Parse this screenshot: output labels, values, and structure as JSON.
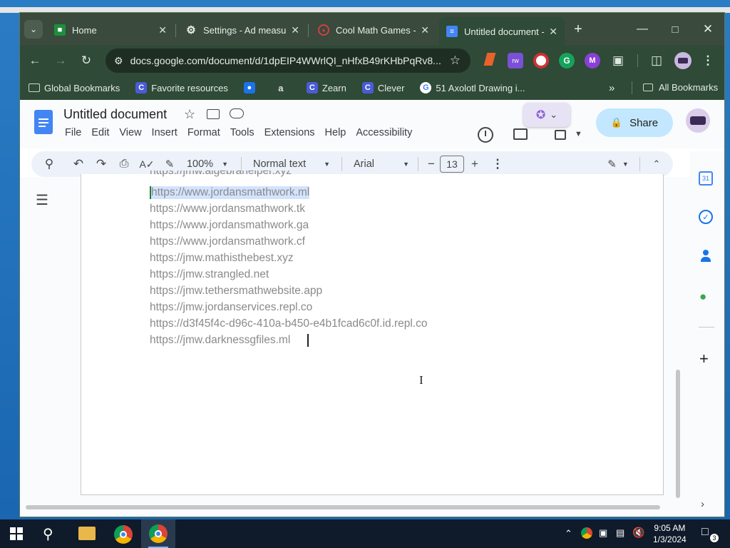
{
  "browser": {
    "tabs": [
      {
        "title": "Home",
        "icon": "classroom-icon",
        "active": false
      },
      {
        "title": "Settings - Ad measu",
        "icon": "gear-icon",
        "active": false
      },
      {
        "title": "Cool Math Games - F",
        "icon": "coolmath-icon",
        "active": false
      },
      {
        "title": "Untitled document -",
        "icon": "docs-icon",
        "active": true
      }
    ],
    "url": "docs.google.com/document/d/1dpEIP4WWrlQI_nHfxB49rKHbPqRv8...",
    "bookmarks": [
      {
        "label": "Global Bookmarks",
        "icon": "folder-icon"
      },
      {
        "label": "Favorite resources",
        "icon": "clever-icon"
      },
      {
        "label": "",
        "icon": "contacts-icon"
      },
      {
        "label": "",
        "icon": "app-icon"
      },
      {
        "label": "Zearn",
        "icon": "clever-icon"
      },
      {
        "label": "Clever",
        "icon": "clever-icon"
      },
      {
        "label": "51 Axolotl Drawing i...",
        "icon": "google-icon"
      }
    ],
    "all_bookmarks": "All Bookmarks",
    "extension_badge": "rw"
  },
  "docs": {
    "title": "Untitled document",
    "menu": [
      "File",
      "Edit",
      "View",
      "Insert",
      "Format",
      "Tools",
      "Extensions",
      "Help",
      "Accessibility"
    ],
    "share_label": "Share",
    "toolbar": {
      "zoom": "100%",
      "style": "Normal text",
      "font": "Arial",
      "font_size": "13"
    },
    "lines": [
      "https://jmw.algebrahelper.xyz",
      "https://www.jordansmathwork.ml",
      "https://www.jordansmathwork.tk",
      "https://www.jordansmathwork.ga",
      "https://www.jordansmathwork.cf",
      "https://jmw.mathisthebest.xyz",
      "https://jmw.strangled.net",
      "https://jmw.tethersmathwebsite.app",
      "https://jmw.jordanservices.repl.co",
      "https://d3f45f4c-d96c-410a-b450-e4b1fcad6c0f.id.repl.co",
      "https://jmw.darknessgfiles.ml"
    ],
    "side_apps": [
      "calendar-icon",
      "tasks-icon",
      "contacts-icon",
      "maps-icon",
      "add-icon"
    ]
  },
  "taskbar": {
    "time": "9:05 AM",
    "date": "1/3/2024",
    "notification_count": "3"
  },
  "colors": {
    "tab_bar": "#3a4a3c",
    "chrome_active": "#2f4a36",
    "docs_blue": "#4285f4",
    "selection": "#d3e3fd"
  }
}
